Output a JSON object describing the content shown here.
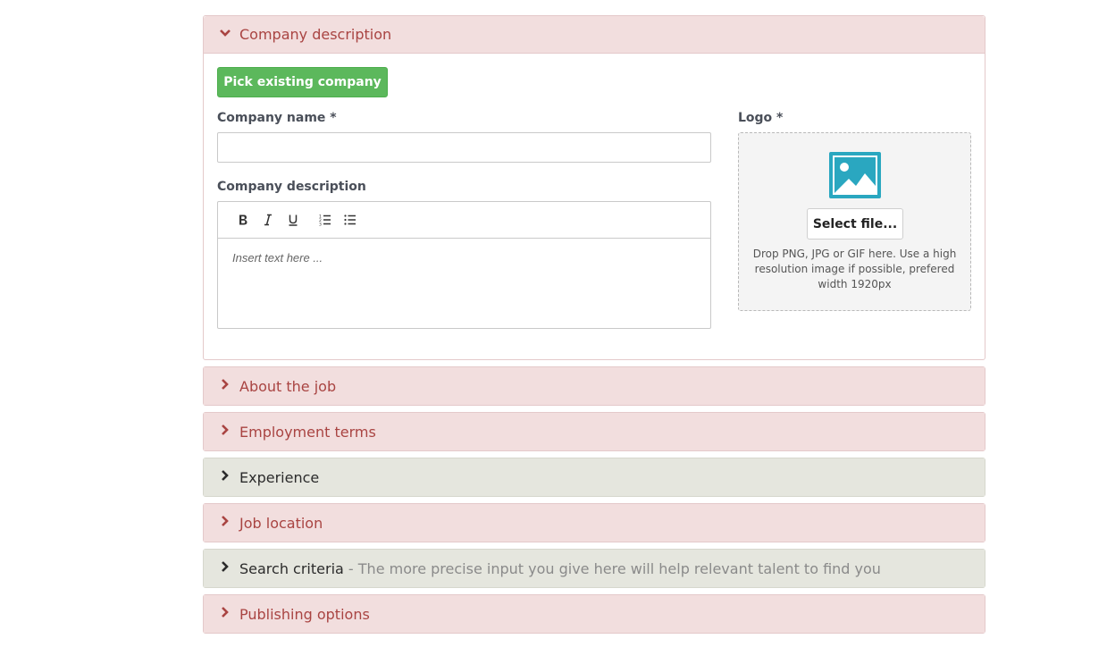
{
  "panels": {
    "company": {
      "title": "Company description",
      "pick_button": "Pick existing company",
      "company_name_label": "Company name *",
      "company_name_value": "",
      "description_label": "Company description",
      "editor_placeholder": "Insert text here ...",
      "toolbar": [
        "bold-icon",
        "italic-icon",
        "underline-icon",
        "ordered-list-icon",
        "unordered-list-icon"
      ],
      "logo_label": "Logo *",
      "select_file": "Select file...",
      "logo_hint": "Drop PNG, JPG or GIF here. Use a high resolution image if possible, prefered width 1920px"
    },
    "about_job": {
      "title": "About the job"
    },
    "employment_terms": {
      "title": "Employment terms"
    },
    "experience": {
      "title": "Experience"
    },
    "job_location": {
      "title": "Job location"
    },
    "search_criteria": {
      "title": "Search criteria",
      "subtitle": " - The more precise input you give here will help relevant talent to find you"
    },
    "publishing_options": {
      "title": "Publishing options"
    }
  },
  "colors": {
    "red_panel_bg": "#f2dede",
    "red_panel_text": "#a94442",
    "gray_panel_bg": "#e5e6de",
    "green_button": "#5cb85c",
    "image_icon": "#2aa7c0"
  }
}
